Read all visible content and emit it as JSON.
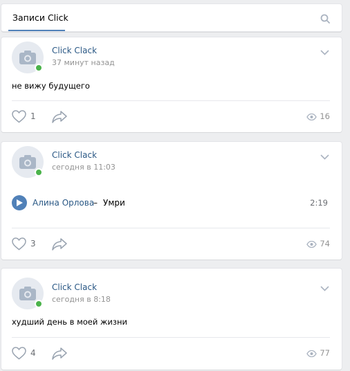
{
  "header": {
    "tab_label": "Записи Click"
  },
  "posts": [
    {
      "author": "Click Clack",
      "time": "37 минут назад",
      "text": "не вижу будущего",
      "likes": "1",
      "views": "16"
    },
    {
      "author": "Click Clack",
      "time": "сегодня в 11:03",
      "audio": {
        "artist": "Алина Орлова",
        "separator": "–",
        "title": "Умри",
        "duration": "2:19"
      },
      "likes": "3",
      "views": "74"
    },
    {
      "author": "Click Clack",
      "time": "сегодня в 8:18",
      "text": "худший день в моей жизни",
      "likes": "4",
      "views": "77"
    }
  ],
  "colors": {
    "link": "#2a5885",
    "accent": "#5181b8",
    "online": "#4bb34b",
    "muted": "#939393"
  }
}
